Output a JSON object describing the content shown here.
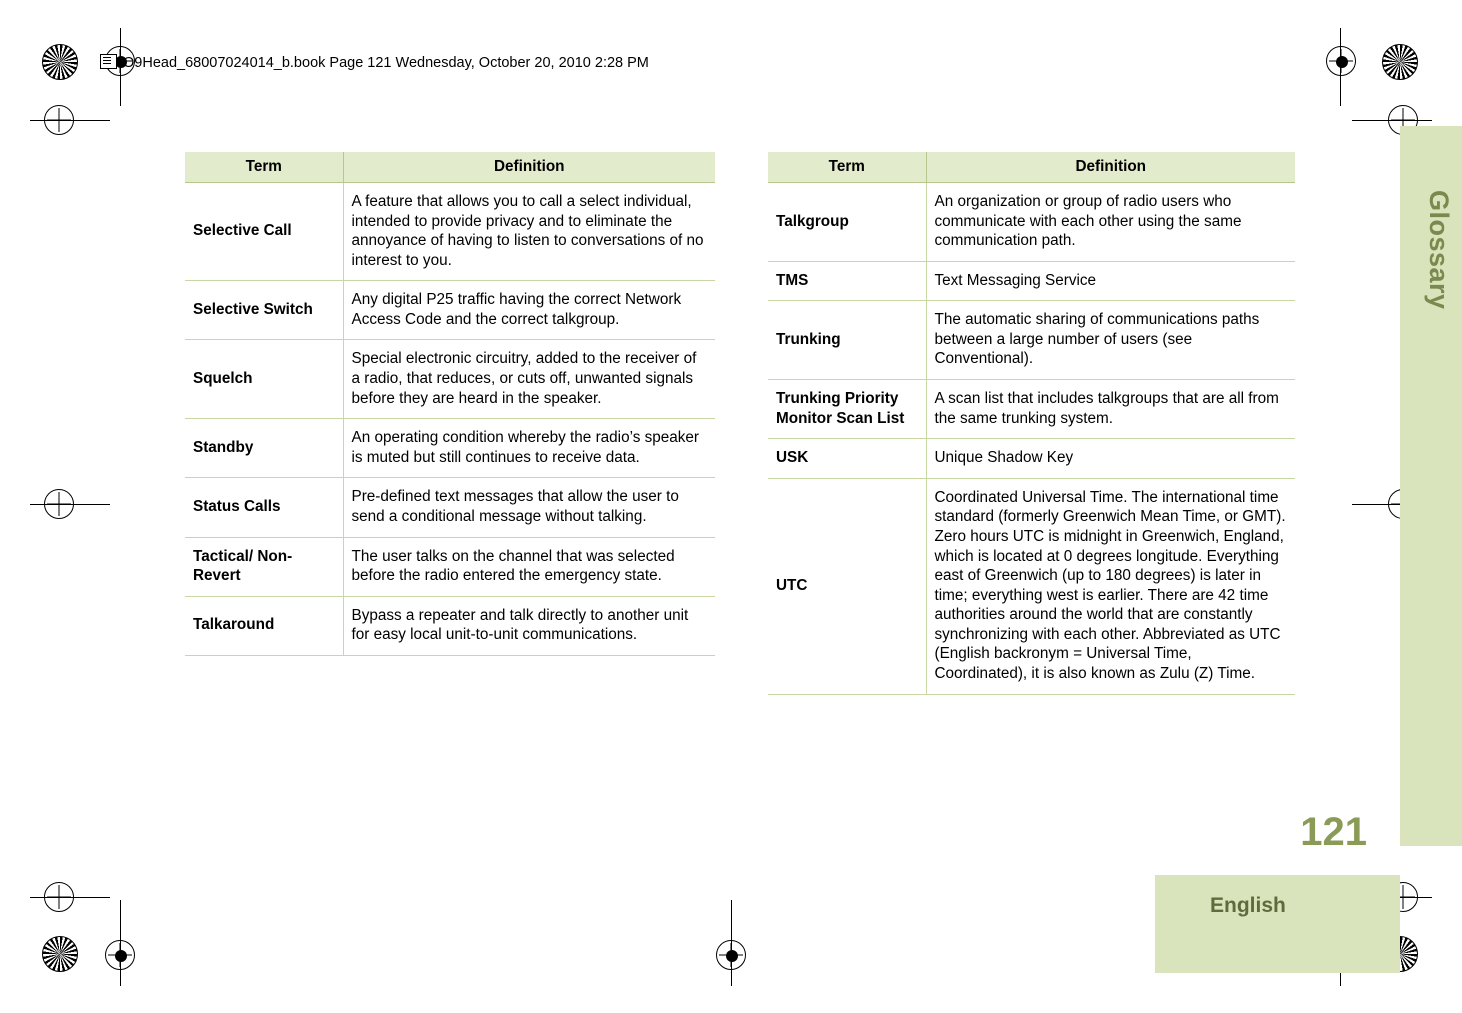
{
  "header": {
    "icon": "book-icon",
    "text": "O9Head_68007024014_b.book  Page 121  Wednesday, October 20, 2010  2:28 PM"
  },
  "chapter_tab": {
    "label": "Glossary"
  },
  "page_number": "121",
  "language_bar": {
    "label": "English"
  },
  "tables": {
    "left": {
      "headers": {
        "term": "Term",
        "definition": "Definition"
      },
      "rows": [
        {
          "term": "Selective Call",
          "definition": "A feature that allows you to call a select individual, intended to provide privacy and to eliminate the annoyance of having to listen to conversations of no interest to you."
        },
        {
          "term": "Selective Switch",
          "definition": "Any digital P25 traffic having the correct Network Access Code and the correct talkgroup."
        },
        {
          "term": "Squelch",
          "definition": "Special electronic circuitry, added to the receiver of a radio, that reduces, or cuts off, unwanted signals before they are heard in the speaker."
        },
        {
          "term": "Standby",
          "definition": "An operating condition whereby the radio’s speaker is muted but still continues to receive data."
        },
        {
          "term": "Status Calls",
          "definition": "Pre-defined text messages that allow the user to send a conditional message without talking."
        },
        {
          "term": "Tactical/ Non-Revert",
          "definition": "The user talks on the channel that was selected before the radio entered the emergency state."
        },
        {
          "term": "Talkaround",
          "definition": "Bypass a repeater and talk directly to another unit for easy local unit-to-unit communications."
        }
      ]
    },
    "right": {
      "headers": {
        "term": "Term",
        "definition": "Definition"
      },
      "rows": [
        {
          "term": "Talkgroup",
          "definition": "An organization or group of radio users who communicate with each other using the same communication path."
        },
        {
          "term": "TMS",
          "definition": "Text Messaging Service"
        },
        {
          "term": "Trunking",
          "definition": "The automatic sharing of communications paths between a large number of users (see Conventional)."
        },
        {
          "term": "Trunking Priority Monitor Scan List",
          "definition": "A scan list that includes talkgroups that are all from the same trunking system."
        },
        {
          "term": "USK",
          "definition": "Unique Shadow Key"
        },
        {
          "term": "UTC",
          "definition": "Coordinated Universal Time. The international time standard (formerly Greenwich Mean Time, or GMT). Zero hours UTC is midnight in Greenwich, England, which is located at 0 degrees longitude. Everything east of Greenwich (up to 180 degrees) is later in time; everything west is earlier. There are 42 time authorities around the world that are constantly synchronizing with each other. Abbreviated as UTC (English backronym = Universal Time, Coordinated), it is also known as Zulu (Z) Time."
        }
      ]
    }
  }
}
